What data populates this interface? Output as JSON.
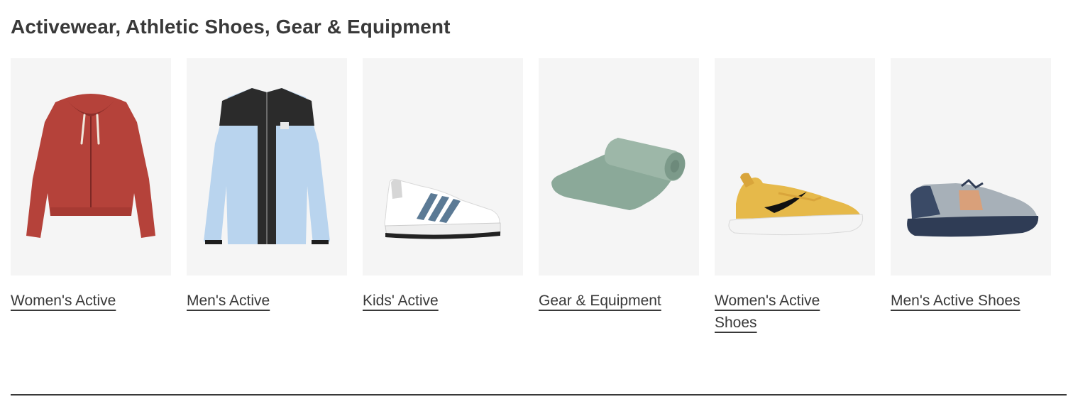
{
  "section": {
    "title": "Activewear, Athletic Shoes, Gear & Equipment"
  },
  "categories": [
    {
      "label": "Women's Active",
      "image_icon": "red-hoodie-image"
    },
    {
      "label": "Men's Active",
      "image_icon": "blue-fleece-jacket-image"
    },
    {
      "label": "Kids' Active",
      "image_icon": "white-sneaker-image"
    },
    {
      "label": "Gear & Equipment",
      "image_icon": "yoga-mat-image"
    },
    {
      "label": "Women's Active Shoes",
      "image_icon": "yellow-running-shoe-image"
    },
    {
      "label": "Men's Active Shoes",
      "image_icon": "grey-trail-shoe-image"
    }
  ],
  "colors": {
    "text": "#393939",
    "tile_background": "#f5f5f5"
  }
}
